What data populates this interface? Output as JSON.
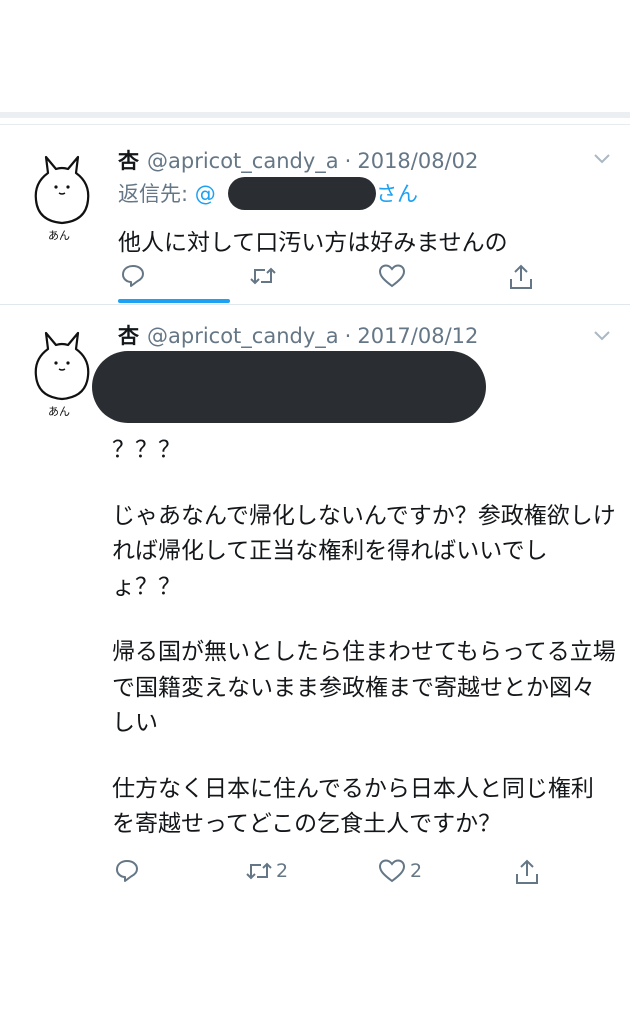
{
  "tweets": [
    {
      "name": "杏",
      "handle": "@apricot_candy_a",
      "date": "2018/08/02",
      "avatar_label": "あん",
      "reply_prefix": "返信先:",
      "reply_handle_start": "@",
      "reply_suffix": "さん",
      "text": "他人に対して口汚い方は好みませんの",
      "actions": {
        "reply": "",
        "retweet": "",
        "like": ""
      }
    },
    {
      "name": "杏",
      "handle": "@apricot_candy_a",
      "date": "2017/08/12",
      "avatar_label": "あん",
      "paragraphs": [
        "？？？",
        "じゃあなんで帰化しないんですか？参政権欲しければ帰化して正当な権利を得ればいいでしょ？？",
        "帰る国が無いとしたら住まわせてもらってる立場で国籍変えないまま参政権まで寄越せとか図々しい",
        "仕方なく日本に住んでるから日本人と同じ権利を寄越せってどこの乞食土人ですか？"
      ],
      "actions": {
        "reply": "",
        "retweet": "2",
        "like": "2"
      }
    }
  ],
  "separator": "·",
  "icons": {
    "reply": "reply-icon",
    "retweet": "retweet-icon",
    "like": "heart-icon",
    "share": "share-icon",
    "menu": "chevron-down-icon"
  },
  "colors": {
    "accent": "#1da1f2",
    "muted": "#657786",
    "text": "#14171a",
    "redaction": "#2a2d31"
  }
}
